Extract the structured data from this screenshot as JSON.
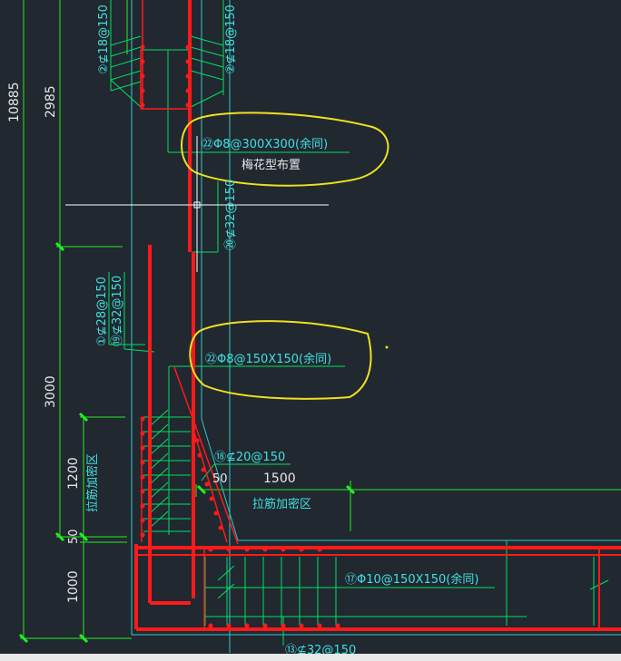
{
  "colors": {
    "background": "#212830",
    "rebar": "#ff1a1a",
    "dim_line": "#22ee22",
    "leader": "#00e060",
    "annotation_text": "#40e0e0",
    "concrete_outline": "#30c8c8",
    "highlight_cloud": "#f0e020",
    "white_text": "#e8e8e8",
    "cursor": "#ffffff"
  },
  "dimensions": {
    "total_height": "10885",
    "upper": "2985",
    "middle": "3000",
    "zone": "1200",
    "offset": "50",
    "bottom": "1000",
    "h_offset": "50",
    "h_span": "1500"
  },
  "labels": {
    "top_left_rebar": "②⊈18@150",
    "top_right_rebar": "②⊈18@150",
    "plum_tie_label": "㉒Φ8@300X300(余同)",
    "plum_tie_sub": "梅花型布置",
    "wall_rebar_20": "⑳⊈32@150",
    "left_rebar_1": "①⊈28@150",
    "left_rebar_19": "⑲⊈32@150",
    "tie_label_2": "㉒Φ8@150X150(余同)",
    "rebar_18": "⑱⊈20@150",
    "zone_v_label": "拉筋加密区",
    "zone_h_label": "拉筋加密区",
    "slab_tie_17": "⑰Φ10@150X150(余同)",
    "bottom_rebar_13": "⑬⊈32@150"
  },
  "icons": {
    "cursor": "crosshair-cursor-icon",
    "callout_circle": "callout-circle-icon"
  }
}
